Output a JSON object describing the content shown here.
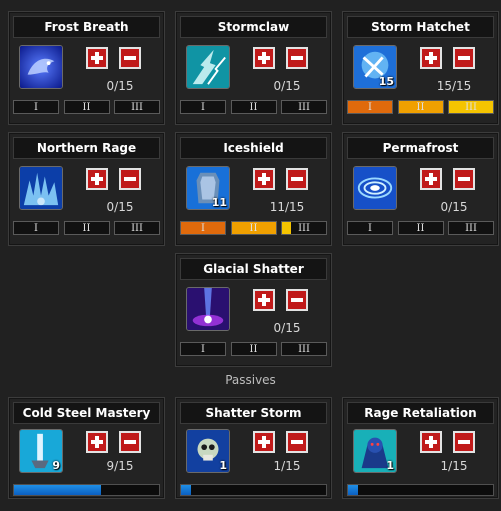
{
  "colors": {
    "tier_fill_orange": "#e06a0c",
    "tier_fill_yellow": "#f5b800",
    "progress_blue": "#1a7fe0",
    "button_red": "#c01a1a"
  },
  "skills": [
    {
      "name": "Frost Breath",
      "icon": "frost-breath-icon",
      "count": "0/15",
      "tiers": [
        "I",
        "II",
        "III"
      ],
      "level": ""
    },
    {
      "name": "Stormclaw",
      "icon": "stormclaw-icon",
      "count": "0/15",
      "tiers": [
        "I",
        "II",
        "III"
      ],
      "level": ""
    },
    {
      "name": "Storm Hatchet",
      "icon": "storm-hatchet-icon",
      "count": "15/15",
      "tiers": [
        "I",
        "II",
        "III"
      ],
      "level": "15",
      "tier_fill": [
        1,
        1,
        1
      ]
    },
    {
      "name": "Northern Rage",
      "icon": "northern-rage-icon",
      "count": "0/15",
      "tiers": [
        "I",
        "II",
        "III"
      ],
      "level": ""
    },
    {
      "name": "Iceshield",
      "icon": "iceshield-icon",
      "count": "11/15",
      "tiers": [
        "I",
        "II",
        "III"
      ],
      "level": "11",
      "tier_fill": [
        1,
        1,
        0.2
      ]
    },
    {
      "name": "Permafrost",
      "icon": "permafrost-icon",
      "count": "0/15",
      "tiers": [
        "I",
        "II",
        "III"
      ],
      "level": ""
    },
    {
      "name": "Glacial Shatter",
      "icon": "glacial-shatter-icon",
      "count": "0/15",
      "tiers": [
        "I",
        "II",
        "III"
      ],
      "level": ""
    }
  ],
  "passives_label": "Passives",
  "passives": [
    {
      "name": "Cold Steel Mastery",
      "icon": "cold-steel-mastery-icon",
      "count": "9/15",
      "level": "9",
      "progress": 0.6
    },
    {
      "name": "Shatter Storm",
      "icon": "shatter-storm-icon",
      "count": "1/15",
      "level": "1",
      "progress": 0.067
    },
    {
      "name": "Rage Retaliation",
      "icon": "rage-retaliation-icon",
      "count": "1/15",
      "level": "1",
      "progress": 0.067
    }
  ]
}
